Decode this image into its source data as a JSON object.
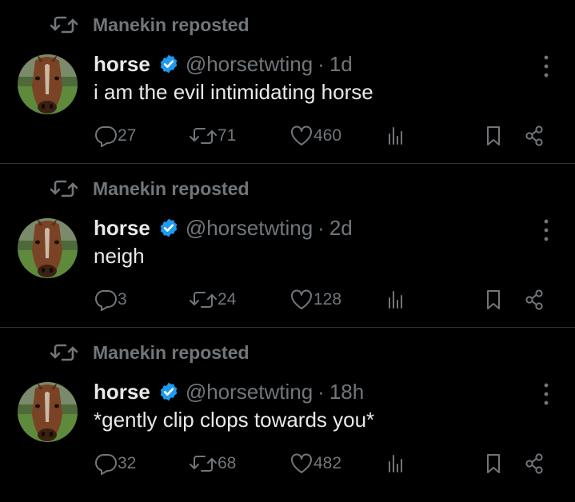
{
  "colors": {
    "background": "#000000",
    "primary_text": "#e7e9ea",
    "secondary_text": "#71767b",
    "divider": "#2f3336",
    "verified": "#1d9bf0"
  },
  "posts": [
    {
      "repost_label": "Manekin reposted",
      "author_name": "horse",
      "handle": "@horsetwting",
      "separator": "·",
      "time": "1d",
      "text": "i am the evil intimidating horse",
      "replies": "27",
      "reposts": "71",
      "likes": "460",
      "icons": [
        "repost-icon",
        "verified-badge-icon",
        "more-icon",
        "reply-icon",
        "repost-icon",
        "like-icon",
        "views-icon",
        "bookmark-icon",
        "share-icon"
      ]
    },
    {
      "repost_label": "Manekin reposted",
      "author_name": "horse",
      "handle": "@horsetwting",
      "separator": "·",
      "time": "2d",
      "text": "neigh",
      "replies": "3",
      "reposts": "24",
      "likes": "128",
      "icons": [
        "repost-icon",
        "verified-badge-icon",
        "more-icon",
        "reply-icon",
        "repost-icon",
        "like-icon",
        "views-icon",
        "bookmark-icon",
        "share-icon"
      ]
    },
    {
      "repost_label": "Manekin reposted",
      "author_name": "horse",
      "handle": "@horsetwting",
      "separator": "·",
      "time": "18h",
      "text": "*gently clip clops towards you*",
      "replies": "32",
      "reposts": "68",
      "likes": "482",
      "icons": [
        "repost-icon",
        "verified-badge-icon",
        "more-icon",
        "reply-icon",
        "repost-icon",
        "like-icon",
        "views-icon",
        "bookmark-icon",
        "share-icon"
      ]
    }
  ]
}
